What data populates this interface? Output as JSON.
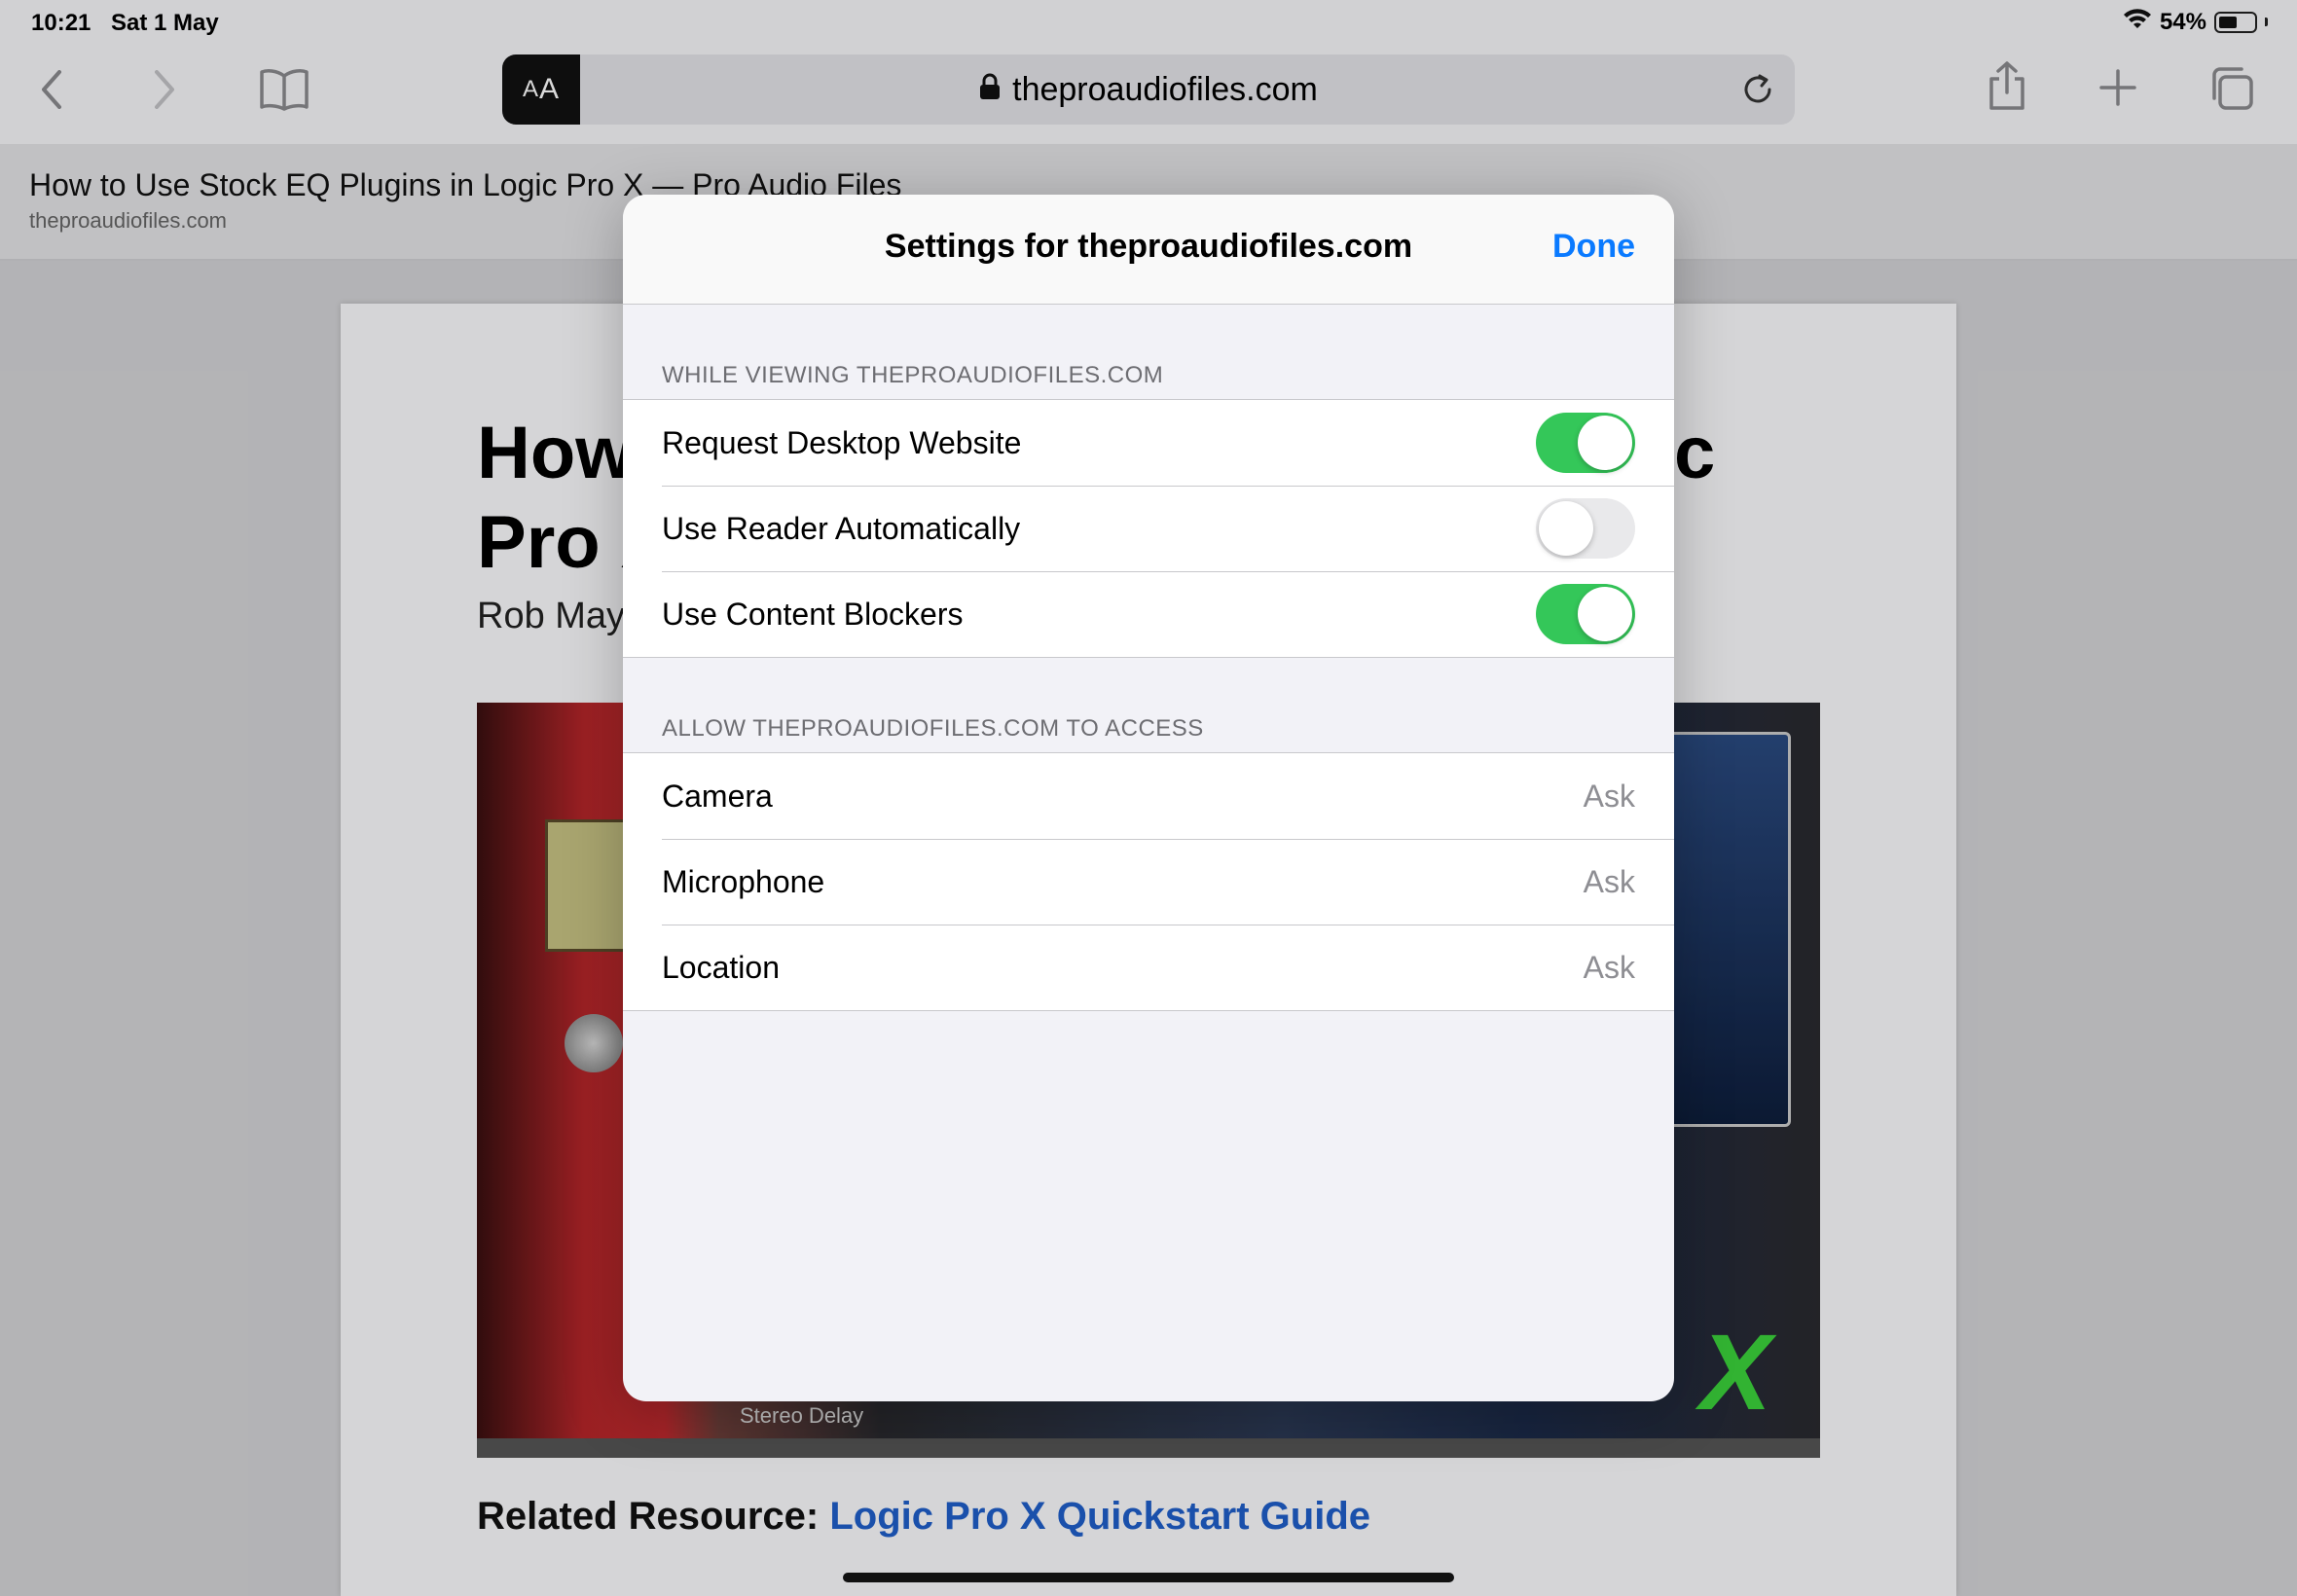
{
  "status": {
    "time": "10:21",
    "date": "Sat 1 May",
    "battery_pct": "54%",
    "battery_level": 0.54
  },
  "toolbar": {
    "reader_button_label_big": "A",
    "reader_button_label_small": "A",
    "address": "theproaudiofiles.com"
  },
  "tab": {
    "title": "How to Use Stock EQ Plugins in Logic Pro X — Pro Audio Files",
    "domain": "theproaudiofiles.com"
  },
  "article": {
    "title_line1": "How",
    "title_line1_end": "c",
    "title_line2": "Pro X",
    "author": "Rob May",
    "image_overlay_text": "X",
    "image_label": "Stereo Delay",
    "related_label": "Related Resource",
    "related_sep": ": ",
    "related_link": "Logic Pro X Quickstart Guide"
  },
  "sheet": {
    "title": "Settings for theproaudiofiles.com",
    "done_label": "Done",
    "viewing_header": "WHILE VIEWING THEPROAUDIOFILES.COM",
    "viewing_rows": [
      {
        "label": "Request Desktop Website",
        "on": true
      },
      {
        "label": "Use Reader Automatically",
        "on": false
      },
      {
        "label": "Use Content Blockers",
        "on": true
      }
    ],
    "access_header": "ALLOW THEPROAUDIOFILES.COM TO ACCESS",
    "access_rows": [
      {
        "label": "Camera",
        "value": "Ask"
      },
      {
        "label": "Microphone",
        "value": "Ask"
      },
      {
        "label": "Location",
        "value": "Ask"
      }
    ]
  },
  "colors": {
    "accent": "#0a7aff",
    "toggle_on": "#34c759",
    "toggle_off": "#e9e9eb",
    "link": "#1f5ec9"
  }
}
